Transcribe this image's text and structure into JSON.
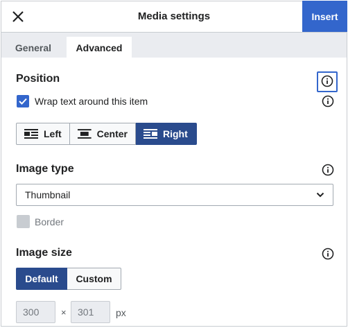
{
  "header": {
    "title": "Media settings",
    "insert_label": "Insert"
  },
  "tabs": [
    {
      "label": "General",
      "active": false
    },
    {
      "label": "Advanced",
      "active": true
    }
  ],
  "position": {
    "title": "Position",
    "wrap_label": "Wrap text around this item",
    "wrap_checked": true,
    "align_options": [
      "Left",
      "Center",
      "Right"
    ],
    "selected_align": "Right"
  },
  "image_type": {
    "title": "Image type",
    "value": "Thumbnail",
    "border_label": "Border",
    "border_checked": false
  },
  "image_size": {
    "title": "Image size",
    "options": [
      "Default",
      "Custom"
    ],
    "selected": "Default",
    "width_placeholder": "300",
    "height_placeholder": "301",
    "times": "×",
    "unit": "px"
  },
  "colors": {
    "accent": "#3366cc",
    "active": "#2a4b8d",
    "tabs_bg": "#eaecf0"
  },
  "icons": [
    "close-icon",
    "info-icon",
    "checkmark-icon",
    "align-left-icon",
    "align-center-icon",
    "align-right-icon",
    "chevron-down-icon"
  ]
}
